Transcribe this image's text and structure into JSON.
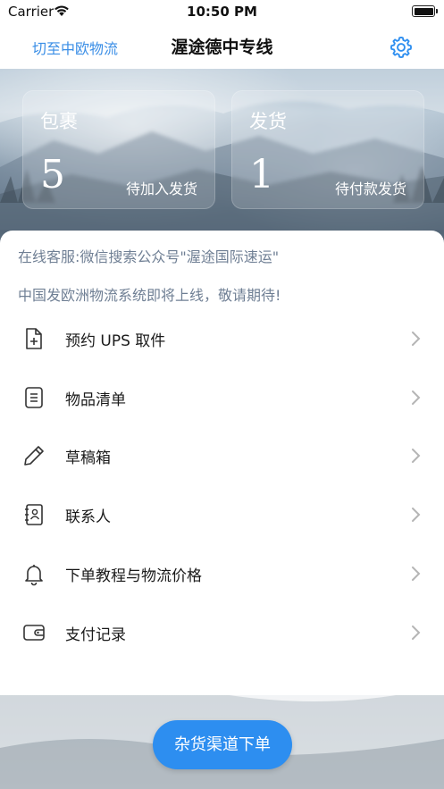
{
  "status_bar": {
    "carrier": "Carrier",
    "time": "10:50 PM",
    "battery_level": 1.0
  },
  "nav": {
    "left_link": "切至中欧物流",
    "title": "渥途德中专线",
    "settings_icon": "gear-icon"
  },
  "stats": [
    {
      "title": "包裹",
      "value": "5",
      "caption": "待加入发货"
    },
    {
      "title": "发货",
      "value": "1",
      "caption": "待付款发货"
    }
  ],
  "notices": {
    "service": "在线客服:微信搜索公众号\"渥途国际速运\"",
    "announcement": "中国发欧洲物流系统即将上线，敬请期待!"
  },
  "menu": [
    {
      "label": "预约 UPS 取件",
      "icon": "add-document-icon"
    },
    {
      "label": "物品清单",
      "icon": "list-document-icon"
    },
    {
      "label": "草稿箱",
      "icon": "pencil-icon"
    },
    {
      "label": "联系人",
      "icon": "contacts-book-icon"
    },
    {
      "label": "下单教程与物流价格",
      "icon": "bell-icon"
    },
    {
      "label": "支付记录",
      "icon": "wallet-icon"
    }
  ],
  "order_button": "杂货渠道下单",
  "colors": {
    "accent": "#2d8ef0",
    "link": "#3a8ee6",
    "notice_text": "#6f7f94"
  }
}
